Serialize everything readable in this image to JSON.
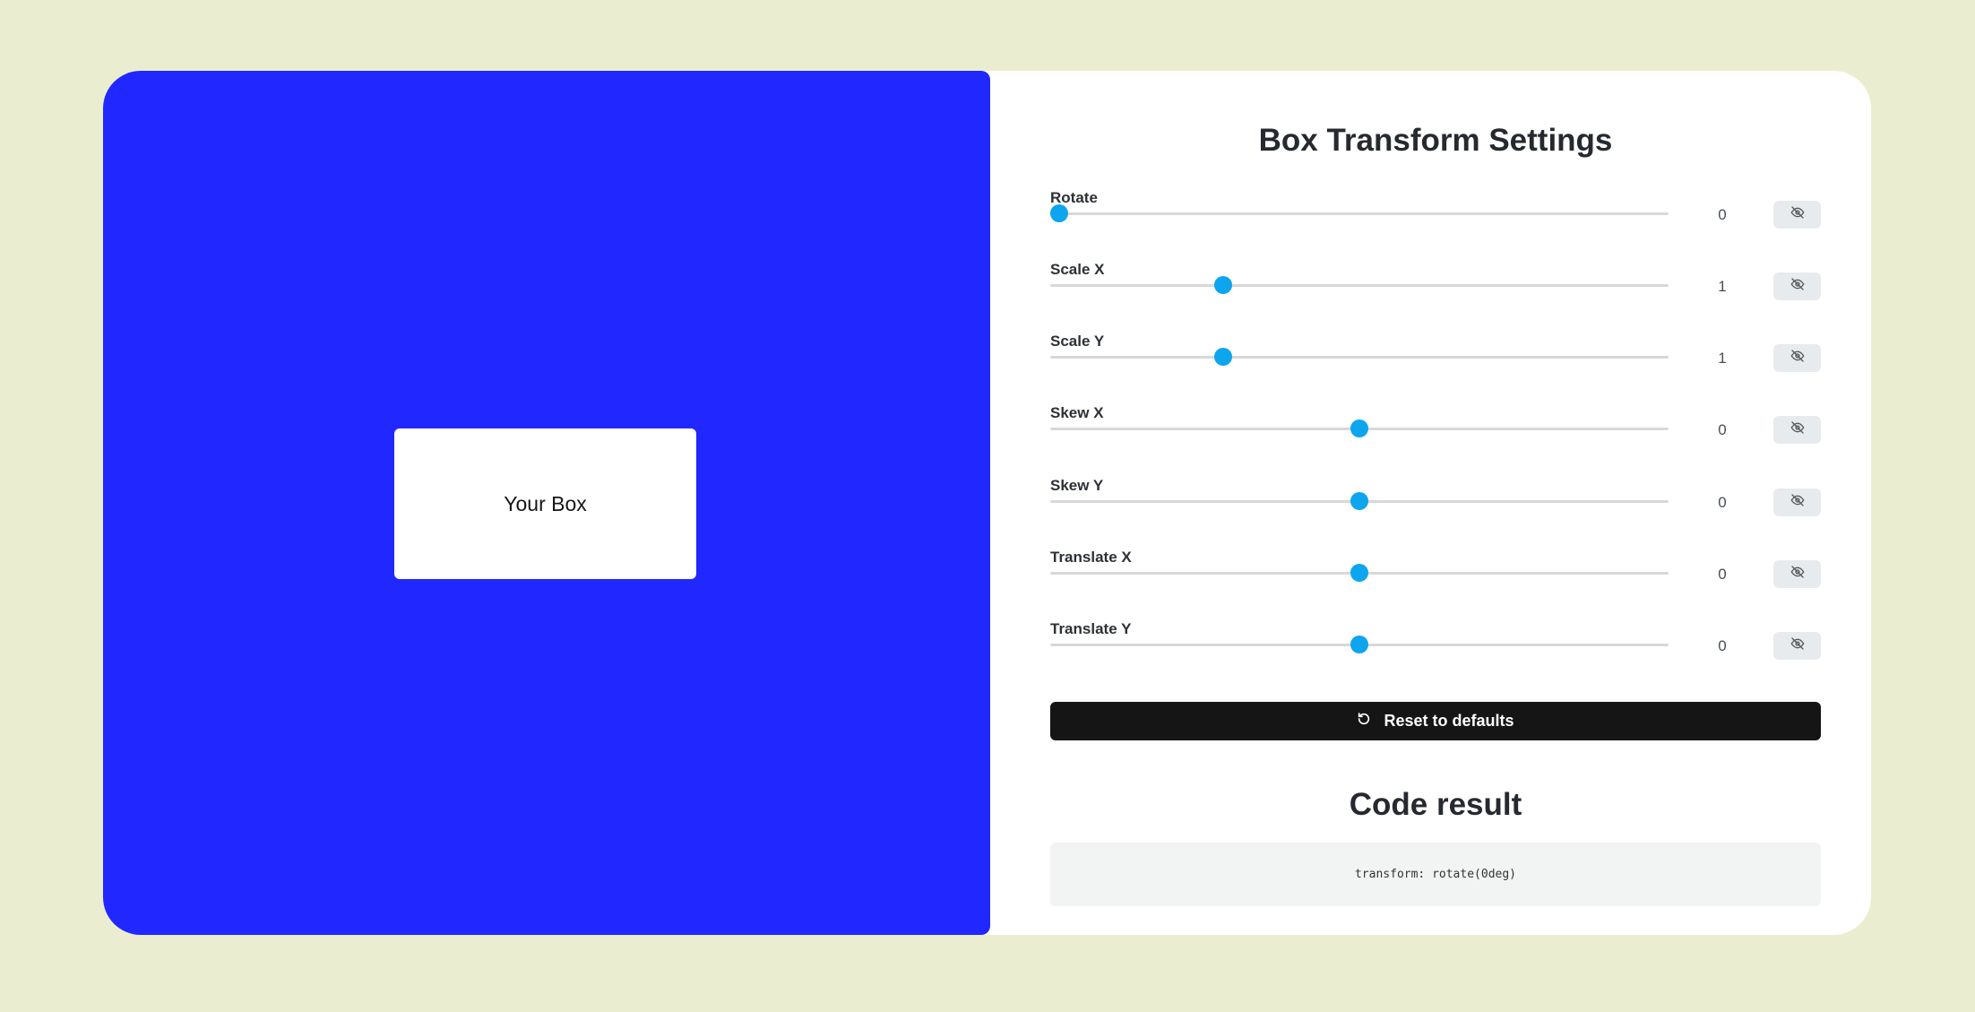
{
  "preview": {
    "box_label": "Your Box",
    "background_color": "#2128ff"
  },
  "settings": {
    "title": "Box Transform Settings",
    "controls": [
      {
        "label": "Rotate",
        "value": "0",
        "slider_fraction": 0.015
      },
      {
        "label": "Scale X",
        "value": "1",
        "slider_fraction": 0.28
      },
      {
        "label": "Scale Y",
        "value": "1",
        "slider_fraction": 0.28
      },
      {
        "label": "Skew X",
        "value": "0",
        "slider_fraction": 0.5
      },
      {
        "label": "Skew Y",
        "value": "0",
        "slider_fraction": 0.5
      },
      {
        "label": "Translate X",
        "value": "0",
        "slider_fraction": 0.5
      },
      {
        "label": "Translate Y",
        "value": "0",
        "slider_fraction": 0.5
      }
    ],
    "toggle_icon": "eye-off-icon",
    "reset_label": "Reset to defaults",
    "reset_icon": "refresh-icon"
  },
  "code": {
    "title": "Code result",
    "value": "transform: rotate(0deg)"
  },
  "colors": {
    "page_background": "#ebedd0",
    "accent": "#0da5ee",
    "button": "#151515"
  }
}
